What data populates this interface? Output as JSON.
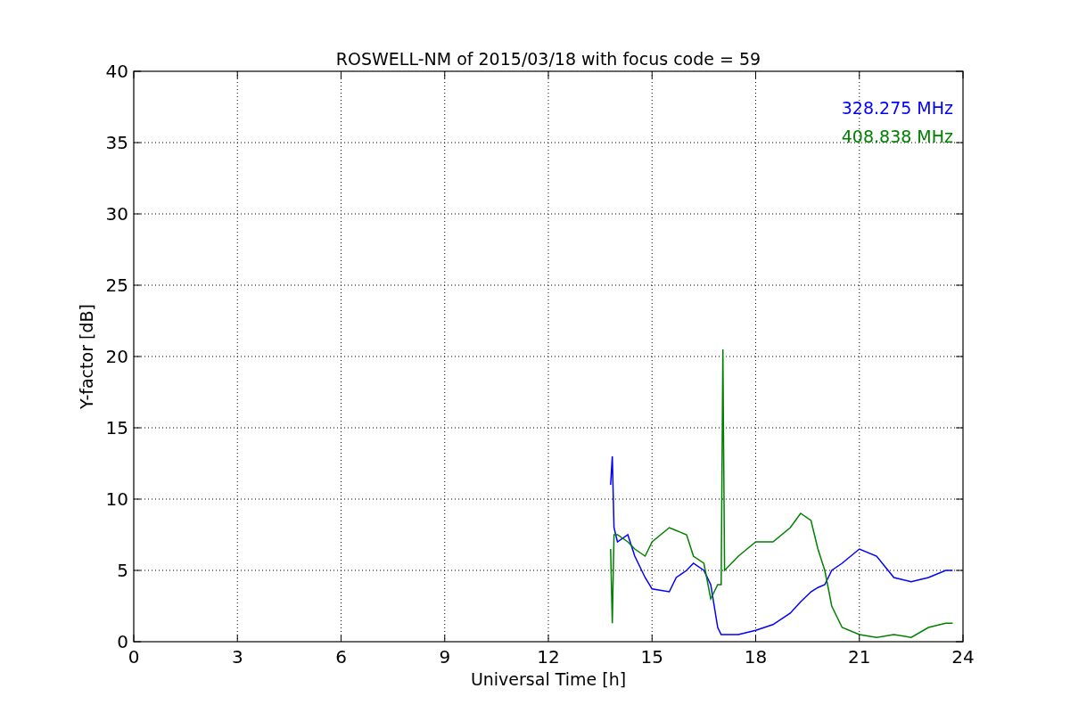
{
  "chart_data": {
    "type": "line",
    "title": "ROSWELL-NM of 2015/03/18 with focus code = 59",
    "xlabel": "Universal Time [h]",
    "ylabel": "Y-factor [dB]",
    "x": [
      13.8,
      13.85,
      13.9,
      14.0,
      14.3,
      14.5,
      14.8,
      15.0,
      15.5,
      15.7,
      16.0,
      16.2,
      16.5,
      16.7,
      16.9,
      17.0,
      17.05,
      17.1,
      17.5,
      18.0,
      18.5,
      19.0,
      19.3,
      19.6,
      19.8,
      20.0,
      20.2,
      20.5,
      21.0,
      21.5,
      22.0,
      22.5,
      23.0,
      23.5,
      23.7
    ],
    "series": [
      {
        "name": "328.275 MHz",
        "color": "#0000ff",
        "values": [
          11,
          13,
          8,
          7,
          7.5,
          6,
          4.5,
          3.7,
          3.5,
          4.5,
          5,
          5.5,
          5,
          4,
          1,
          0.5,
          0.5,
          0.5,
          0.5,
          0.8,
          1.2,
          2,
          2.8,
          3.5,
          3.8,
          4,
          5,
          5.5,
          6.5,
          6,
          4.5,
          4.2,
          4.5,
          5,
          5
        ]
      },
      {
        "name": "408.838 MHz",
        "color": "#008000",
        "values": [
          6.5,
          1.3,
          7.5,
          7.5,
          7,
          6.5,
          6,
          7,
          8,
          7.8,
          7.5,
          6,
          5.5,
          3,
          4,
          4,
          20.5,
          5,
          6,
          7,
          7,
          8,
          9,
          8.5,
          6.5,
          5,
          2.5,
          1,
          0.5,
          0.3,
          0.5,
          0.3,
          1,
          1.3,
          1.3
        ]
      }
    ],
    "grid": true,
    "xlim": [
      0,
      24
    ],
    "ylim": [
      0,
      40
    ],
    "xticks": [
      0,
      3,
      6,
      9,
      12,
      15,
      18,
      21,
      24
    ],
    "yticks": [
      0,
      5,
      10,
      15,
      20,
      25,
      30,
      35,
      40
    ]
  }
}
